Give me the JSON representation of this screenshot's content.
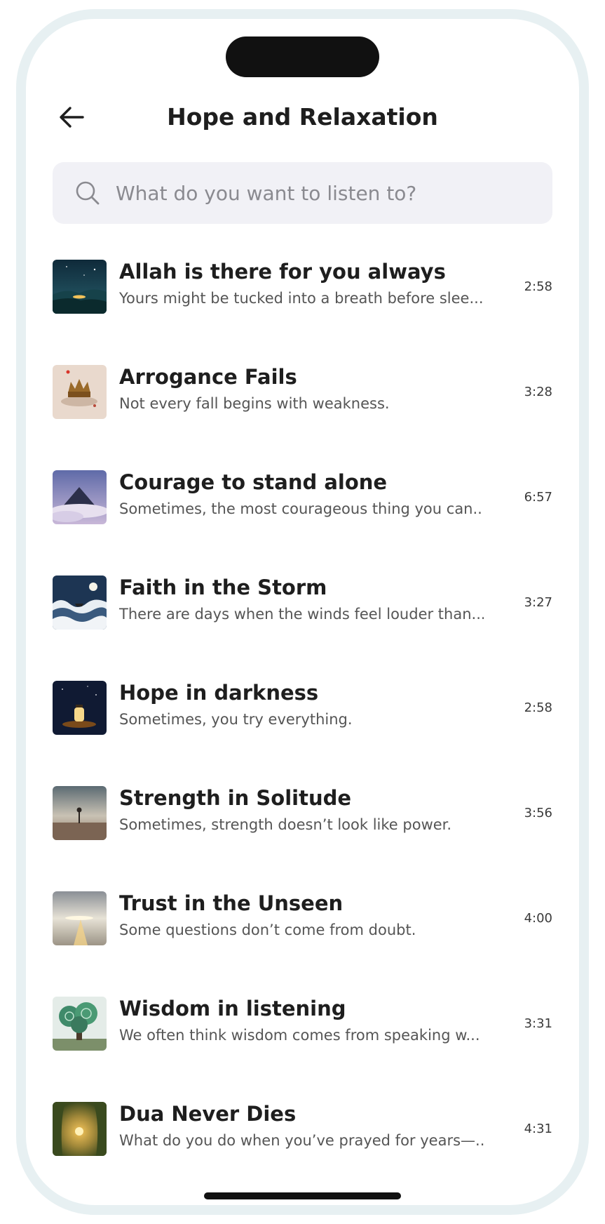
{
  "header": {
    "title": "Hope and Relaxation",
    "back_icon": "arrow-left-icon"
  },
  "search": {
    "placeholder": "What do you want to listen to?",
    "value": "",
    "icon": "search-icon"
  },
  "tracks": [
    {
      "title": "Allah is there for you always",
      "subtitle": "Yours might be tucked into a breath before slee...",
      "duration": "2:58",
      "thumbnail": "night-valley-glow"
    },
    {
      "title": "Arrogance Fails",
      "subtitle": "Not every fall begins with weakness.",
      "duration": "3:28",
      "thumbnail": "fallen-crown"
    },
    {
      "title": "Courage to stand alone",
      "subtitle": "Sometimes, the most courageous thing you can...",
      "duration": "6:57",
      "thumbnail": "mountain-above-clouds"
    },
    {
      "title": "Faith in the Storm",
      "subtitle": "There are days when the winds feel louder than...",
      "duration": "3:27",
      "thumbnail": "boat-on-waves"
    },
    {
      "title": "Hope in darkness",
      "subtitle": "Sometimes, you try everything.",
      "duration": "2:58",
      "thumbnail": "lantern-at-night"
    },
    {
      "title": "Strength in Solitude",
      "subtitle": "Sometimes, strength doesn’t look like power.",
      "duration": "3:56",
      "thumbnail": "lone-tree-desert"
    },
    {
      "title": "Trust in the Unseen",
      "subtitle": "Some questions don’t come from doubt.",
      "duration": "4:00",
      "thumbnail": "light-path"
    },
    {
      "title": "Wisdom in listening",
      "subtitle": "We often think wisdom comes from speaking w...",
      "duration": "3:31",
      "thumbnail": "swirl-tree"
    },
    {
      "title": "Dua Never Dies",
      "subtitle": "What do you do when you’ve prayed for years—...",
      "duration": "4:31",
      "thumbnail": "forest-sunset"
    }
  ]
}
